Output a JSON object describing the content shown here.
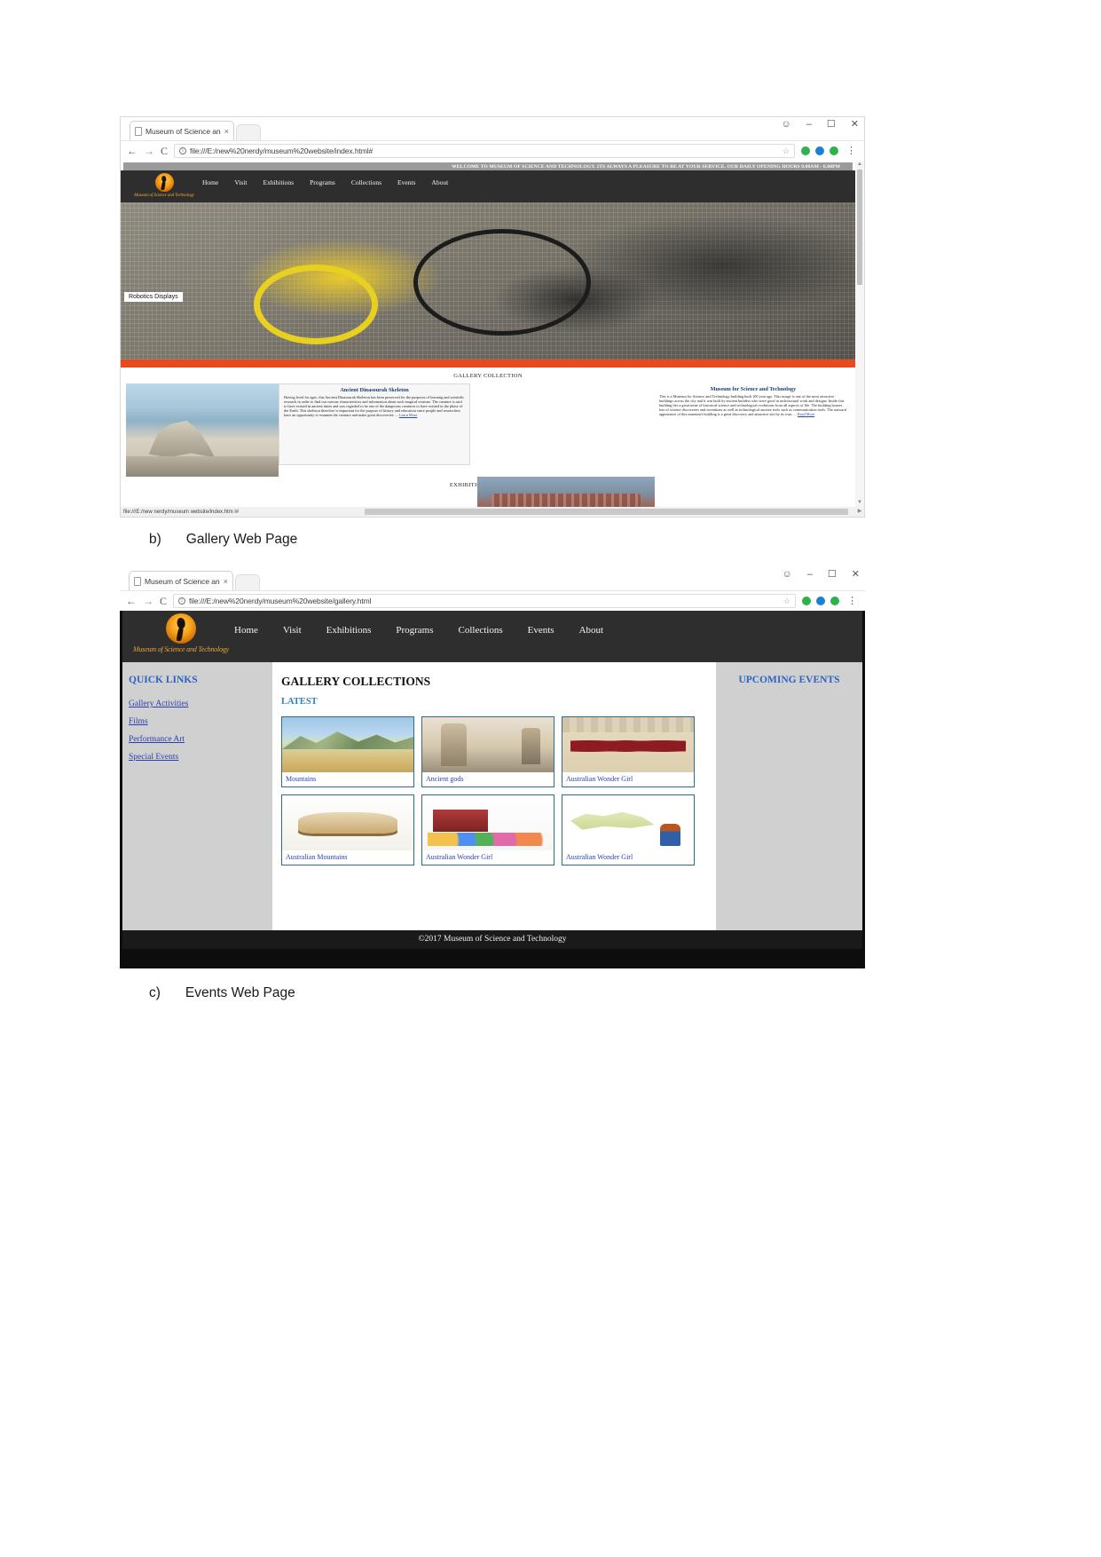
{
  "document": {
    "captions": [
      {
        "marker": "b)",
        "text": "Gallery Web Page"
      },
      {
        "marker": "c)",
        "text": "Events Web Page"
      }
    ]
  },
  "browser_chrome": {
    "tab_title": "Museum of Science and",
    "tab_close": "×",
    "back_arrow": "←",
    "forward_arrow": "→",
    "reload": "C",
    "info_icon": "i",
    "star": "☆",
    "menu": "⋮",
    "window_user": "●",
    "window_minimize": "–",
    "window_maximize": "☐",
    "window_close": "✕",
    "ext_labels": [
      "G",
      "B",
      "G"
    ]
  },
  "home_window": {
    "url": "file:///E:/new%20nerdy/museum%20website/index.html#",
    "status_url": "file:///E:/new nerdy/museum website/index.htm l#",
    "marquee": "WELCOME TO MUSEUM OF SCIENCE AND TECHNOLOGY. ITS ALWAYS A PLEASURE TO BE AT YOUR SERVICE. OUR DAILY OPENING HOURS 9.00AM - 6.00PM",
    "logo_text": "Museum of Science and Technology",
    "nav": [
      "Home",
      "Visit",
      "Exhibitions",
      "Programs",
      "Collections",
      "Events",
      "About"
    ],
    "hero_caption": "Robotics Displays",
    "gallery_heading": "GALLERY COLLECTION",
    "exhibition_heading": "EXHIBITION COLLECTION",
    "cards": [
      {
        "title": "Ancient Dinasourah Skeleton",
        "body": "Having lived for ages, this Ancient Dinasourah Skeleton has been preserved for the purposes of learning and scientific research in order to find out various characteristics and information about such magical creature. The creature is said to have existed in ancient times and was regarded to be one of the dangerous creatures to have existed in the phase of the Earth. This skeleton therefore is important for the purpose of history and education since people and researchers have an opportunity to examine the creature and make great discoveries. ...",
        "link": "Learn More"
      },
      {
        "title": "Museum for Science and Technology",
        "body": "This is a Museum for Science and Technology building built 100 year ago. This image is one of the most attractive buildings across the city and it was built by ancient builders who were good in architectural work and designs. Inside this building lies a great mine of historical science and technological evolutions from all aspects of life. The building houses lots of science discoveries and inventions as well as technological ancient tools such as communication tools. The outward appearance of this museum's building is a great discovery and attractive site by its own. ...",
        "link": "Read More"
      }
    ]
  },
  "gallery_window": {
    "url": "file:///E:/new%20nerdy/museum%20website/gallery.html",
    "logo_text": "Museum of Science and Technology",
    "nav": [
      "Home",
      "Visit",
      "Exhibitions",
      "Programs",
      "Collections",
      "Events",
      "About"
    ],
    "sidebar": {
      "title": "QUICK LINKS",
      "links": [
        "Gallery Activities",
        "Films",
        "Performance Art",
        "Special Events"
      ]
    },
    "main": {
      "heading": "GALLERY COLLECTIONS",
      "subheading": "LATEST",
      "items": [
        {
          "caption": "Mountains",
          "thumb": "mountains-thumb"
        },
        {
          "caption": "Ancient gods",
          "thumb": "ancient-gods-thumb"
        },
        {
          "caption": "Australian Wonder Girl",
          "thumb": "wonder-girl-thumb"
        },
        {
          "caption": "Australian Mountains",
          "thumb": "australian-mountains-thumb"
        },
        {
          "caption": "Australian Wonder Girl",
          "thumb": "kids-thumb"
        },
        {
          "caption": "Australian Wonder Girl",
          "thumb": "dino-thumb"
        }
      ]
    },
    "right_panel": {
      "title": "UPCOMING EVENTS"
    },
    "footer": "©2017 Museum of Science and Technology"
  },
  "colors": {
    "header_bg": "#2e2e2e",
    "accent_orange": "#e8491d",
    "logo_gold": "#e8a33d",
    "link_blue": "#2a3fb0",
    "heading_blue": "#2b63c6",
    "panel_grey": "#d0d0d0"
  }
}
